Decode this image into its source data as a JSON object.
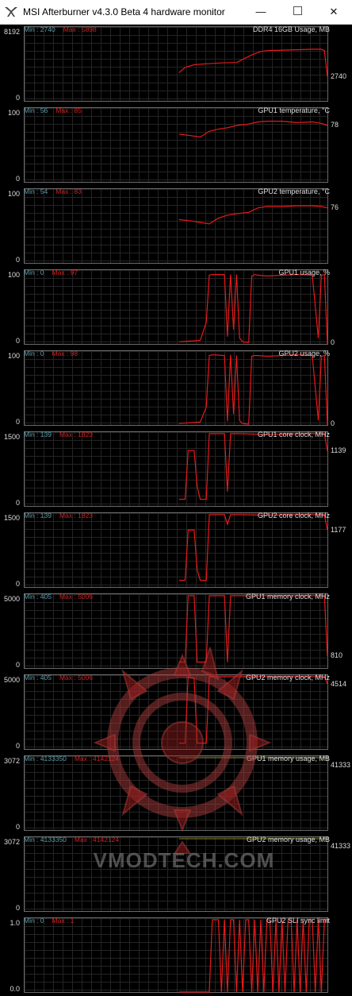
{
  "window": {
    "title": "MSI Afterburner v4.3.0 Beta 4 hardware monitor",
    "icon": "afterburner-logo-icon",
    "minimize_symbol": "—",
    "close_symbol": "✕"
  },
  "watermark": {
    "text": "VMODTECH.COM"
  },
  "colors": {
    "series": "#e8191a",
    "min_text": "#5b9ca7",
    "max_text": "#d22222",
    "grid": "#242424"
  },
  "chart_data": [
    {
      "type": "line",
      "title": "DDR4 16GB Usage, MB",
      "min_label": "Min : 2740",
      "max_label": "Max : 5898",
      "ymax_label": "8192",
      "ymin_label": "0",
      "ylim": [
        0,
        8192
      ],
      "current": "2740",
      "x": [
        0,
        0.51,
        0.53,
        0.56,
        0.6,
        0.65,
        0.7,
        0.72,
        0.75,
        0.78,
        0.8,
        0.85,
        0.9,
        0.95,
        0.98,
        0.99,
        1.0
      ],
      "y": [
        null,
        3200,
        3800,
        4100,
        4200,
        4300,
        4350,
        4700,
        5200,
        5600,
        5700,
        5750,
        5800,
        5850,
        5850,
        5700,
        2740
      ]
    },
    {
      "type": "line",
      "title": "GPU1 temperature, °C",
      "min_label": "Min : 56",
      "max_label": "Max : 85",
      "ymax_label": "100",
      "ymin_label": "0",
      "ylim": [
        0,
        100
      ],
      "current": "78",
      "x": [
        0,
        0.51,
        0.55,
        0.58,
        0.61,
        0.64,
        0.67,
        0.7,
        0.74,
        0.77,
        0.8,
        0.85,
        0.9,
        0.95,
        0.98,
        1.0
      ],
      "y": [
        null,
        66,
        64,
        62,
        70,
        73,
        75,
        78,
        80,
        83,
        84,
        84,
        82,
        83,
        81,
        78
      ]
    },
    {
      "type": "line",
      "title": "GPU2 temperature, °C",
      "min_label": "Min : 54",
      "max_label": "Max : 83",
      "ymax_label": "100",
      "ymin_label": "0",
      "ylim": [
        0,
        100
      ],
      "current": "76",
      "x": [
        0,
        0.51,
        0.55,
        0.58,
        0.61,
        0.64,
        0.67,
        0.7,
        0.74,
        0.77,
        0.8,
        0.85,
        0.9,
        0.95,
        0.98,
        1.0
      ],
      "y": [
        null,
        60,
        58,
        56,
        54,
        62,
        66,
        68,
        70,
        76,
        78,
        78,
        79,
        79,
        78,
        76
      ]
    },
    {
      "type": "line",
      "title": "GPU1 usage, %",
      "min_label": "Min : 0",
      "max_label": "Max : 97",
      "ymax_label": "100",
      "ymin_label": "0",
      "ylim": [
        0,
        100
      ],
      "current": "0",
      "x": [
        0,
        0.51,
        0.58,
        0.6,
        0.61,
        0.62,
        0.66,
        0.67,
        0.68,
        0.69,
        0.7,
        0.71,
        0.72,
        0.74,
        0.75,
        0.76,
        0.77,
        0.8,
        0.85,
        0.9,
        0.95,
        0.97,
        0.98,
        0.99,
        1.0
      ],
      "y": [
        null,
        3,
        5,
        30,
        95,
        96,
        96,
        10,
        96,
        20,
        96,
        8,
        3,
        2,
        94,
        96,
        95,
        94,
        95,
        96,
        95,
        8,
        95,
        96,
        0
      ]
    },
    {
      "type": "line",
      "title": "GPU2 usage, %",
      "min_label": "Min : 0",
      "max_label": "Max : 98",
      "ymax_label": "100",
      "ymin_label": "0",
      "ylim": [
        0,
        100
      ],
      "current": "0",
      "x": [
        0,
        0.51,
        0.58,
        0.6,
        0.61,
        0.62,
        0.66,
        0.67,
        0.68,
        0.69,
        0.7,
        0.71,
        0.72,
        0.74,
        0.75,
        0.76,
        0.77,
        0.8,
        0.85,
        0.9,
        0.95,
        0.97,
        0.98,
        0.99,
        1.0
      ],
      "y": [
        null,
        2,
        4,
        25,
        96,
        97,
        96,
        5,
        97,
        15,
        96,
        6,
        2,
        1,
        95,
        96,
        96,
        95,
        96,
        97,
        96,
        6,
        95,
        96,
        0
      ]
    },
    {
      "type": "line",
      "title": "GPU1 core clock, MHz",
      "min_label": "Min : 139",
      "max_label": "Max : 1823",
      "ymax_label": "1500",
      "ymin_label": "0",
      "ylim": [
        0,
        1500
      ],
      "current": "1139",
      "x": [
        0,
        0.51,
        0.53,
        0.54,
        0.56,
        0.57,
        0.58,
        0.6,
        0.61,
        0.62,
        0.66,
        0.67,
        0.68,
        0.69,
        0.7,
        0.71,
        0.8,
        0.9,
        0.99,
        1.0
      ],
      "y": [
        null,
        139,
        139,
        1150,
        1150,
        400,
        139,
        139,
        1500,
        1500,
        1500,
        300,
        1500,
        1500,
        1500,
        1500,
        1480,
        1500,
        1500,
        1139
      ]
    },
    {
      "type": "line",
      "title": "GPU2 core clock, MHz",
      "min_label": "Min : 139",
      "max_label": "Max : 1823",
      "ymax_label": "1500",
      "ymin_label": "0",
      "ylim": [
        0,
        1500
      ],
      "current": "1177",
      "x": [
        0,
        0.51,
        0.53,
        0.54,
        0.56,
        0.57,
        0.58,
        0.6,
        0.61,
        0.62,
        0.66,
        0.67,
        0.68,
        0.69,
        0.7,
        0.71,
        0.8,
        0.9,
        0.99,
        1.0
      ],
      "y": [
        null,
        139,
        139,
        1180,
        1180,
        350,
        139,
        139,
        1500,
        1500,
        1500,
        1300,
        1500,
        1500,
        1500,
        1500,
        1490,
        1500,
        1500,
        1177
      ]
    },
    {
      "type": "line",
      "title": "GPU1 memory clock, MHz",
      "min_label": "Min : 405",
      "max_label": "Max : 5006",
      "ymax_label": "5000",
      "ymin_label": "0",
      "ylim": [
        0,
        5000
      ],
      "current": "810",
      "x": [
        0,
        0.51,
        0.53,
        0.54,
        0.56,
        0.57,
        0.58,
        0.6,
        0.61,
        0.62,
        0.66,
        0.67,
        0.68,
        0.7,
        0.8,
        0.9,
        0.99,
        1.0
      ],
      "y": [
        null,
        405,
        405,
        5000,
        5000,
        405,
        405,
        405,
        5000,
        5000,
        5000,
        405,
        5000,
        5000,
        5000,
        5000,
        5000,
        810
      ]
    },
    {
      "type": "line",
      "title": "GPU2 memory clock, MHz",
      "min_label": "Min : 405",
      "max_label": "Max : 5006",
      "ymax_label": "5000",
      "ymin_label": "0",
      "ylim": [
        0,
        5000
      ],
      "current": "4514",
      "x": [
        0,
        0.51,
        0.53,
        0.54,
        0.56,
        0.57,
        0.58,
        0.6,
        0.61,
        0.62,
        0.66,
        0.68,
        0.7,
        0.8,
        0.9,
        0.99,
        1.0
      ],
      "y": [
        null,
        405,
        405,
        5000,
        4900,
        405,
        405,
        405,
        5000,
        5000,
        5000,
        5000,
        5000,
        5000,
        5000,
        5000,
        4514
      ]
    },
    {
      "type": "line",
      "title": "GPU1 memory usage, MB",
      "min_label": "Min : 4133350",
      "max_label": "Max : 4142124",
      "ymax_label": "3072",
      "ymin_label": "0",
      "ylim": [
        0,
        3072
      ],
      "current": "41333",
      "x": [
        0.51,
        1.0
      ],
      "y": [
        3072,
        3072
      ]
    },
    {
      "type": "line",
      "title": "GPU2 memory usage, MB",
      "min_label": "Min : 4133350",
      "max_label": "Max : 4142124",
      "ymax_label": "3072",
      "ymin_label": "0",
      "ylim": [
        0,
        3072
      ],
      "current": "41333",
      "x": [
        0.51,
        1.0
      ],
      "y": [
        3072,
        3072
      ]
    },
    {
      "type": "line",
      "title": "GPU2 SLI sync limit",
      "min_label": "Min : 0",
      "max_label": "Max : 1",
      "ymax_label": "1.0",
      "ymin_label": "0.0",
      "ylim": [
        0,
        1
      ],
      "current": "",
      "x": [
        0,
        0.51,
        0.61,
        0.62,
        0.63,
        0.64,
        0.65,
        0.66,
        0.67,
        0.68,
        0.69,
        0.7,
        0.71,
        0.72,
        0.73,
        0.74,
        0.75,
        0.76,
        0.77,
        0.78,
        0.79,
        0.8,
        0.81,
        0.82,
        0.83,
        0.84,
        0.85,
        0.86,
        0.87,
        0.88,
        0.89,
        0.9,
        0.91,
        0.92,
        0.93,
        0.94,
        0.95,
        0.96,
        0.97,
        0.98,
        0.99,
        1.0
      ],
      "y": [
        null,
        0,
        0,
        1,
        1,
        1,
        0,
        1,
        0,
        1,
        1,
        0,
        1,
        0,
        1,
        1,
        0,
        1,
        0,
        1,
        0,
        1,
        1,
        0,
        1,
        0,
        1,
        0,
        1,
        1,
        0,
        1,
        0,
        1,
        0,
        1,
        1,
        0,
        1,
        0,
        1,
        1
      ]
    }
  ]
}
